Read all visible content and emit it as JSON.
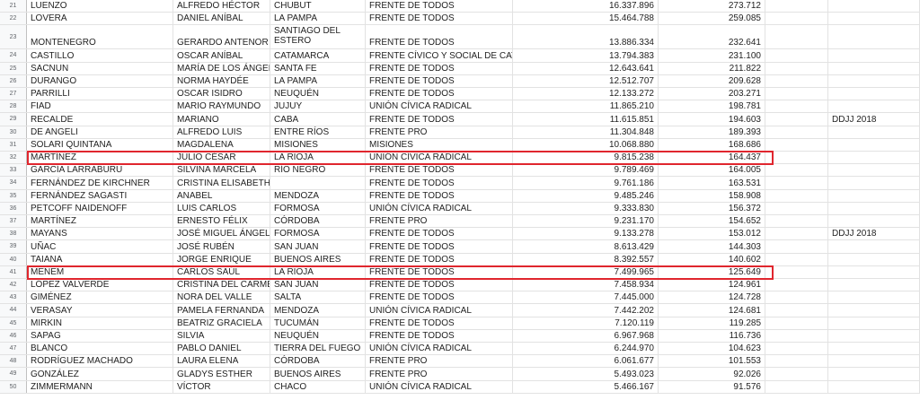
{
  "rows": [
    {
      "n": "21",
      "surname": "LUENZO",
      "name": "ALFREDO HÉCTOR",
      "province": "CHUBUT",
      "party": "FRENTE DE TODOS",
      "value1": "16.337.896",
      "value2": "273.712",
      "note": ""
    },
    {
      "n": "22",
      "surname": "LOVERA",
      "name": "DANIEL ANÍBAL",
      "province": "LA PAMPA",
      "party": "FRENTE DE TODOS",
      "value1": "15.464.788",
      "value2": "259.085",
      "note": ""
    },
    {
      "n": "23",
      "surname": "MONTENEGRO",
      "name": "GERARDO ANTENOR",
      "province": "SANTIAGO DEL ESTERO",
      "party": "FRENTE DE TODOS",
      "value1": "13.886.334",
      "value2": "232.641",
      "note": ""
    },
    {
      "n": "24",
      "surname": "CASTILLO",
      "name": "OSCAR ANÍBAL",
      "province": "CATAMARCA",
      "party": "FRENTE CÍVICO Y SOCIAL DE CATAMARCA",
      "value1": "13.794.383",
      "value2": "231.100",
      "note": ""
    },
    {
      "n": "25",
      "surname": "SACNUN",
      "name": "MARÍA DE LOS ÁNGELES",
      "province": "SANTA FE",
      "party": "FRENTE DE TODOS",
      "value1": "12.643.641",
      "value2": "211.822",
      "note": ""
    },
    {
      "n": "26",
      "surname": "DURANGO",
      "name": "NORMA HAYDÉE",
      "province": "LA PAMPA",
      "party": "FRENTE DE TODOS",
      "value1": "12.512.707",
      "value2": "209.628",
      "note": ""
    },
    {
      "n": "27",
      "surname": "PARRILLI",
      "name": "OSCAR ISIDRO",
      "province": "NEUQUÉN",
      "party": "FRENTE DE TODOS",
      "value1": "12.133.272",
      "value2": "203.271",
      "note": ""
    },
    {
      "n": "28",
      "surname": "FIAD",
      "name": "MARIO RAYMUNDO",
      "province": "JUJUY",
      "party": "UNIÓN CÍVICA RADICAL",
      "value1": "11.865.210",
      "value2": "198.781",
      "note": ""
    },
    {
      "n": "29",
      "surname": "RECALDE",
      "name": "MARIANO",
      "province": "CABA",
      "party": "FRENTE DE TODOS",
      "value1": "11.615.851",
      "value2": "194.603",
      "note": "DDJJ 2018"
    },
    {
      "n": "30",
      "surname": "DE ANGELI",
      "name": "ALFREDO LUIS",
      "province": "ENTRE RÍOS",
      "party": "FRENTE PRO",
      "value1": "11.304.848",
      "value2": "189.393",
      "note": ""
    },
    {
      "n": "31",
      "surname": "SOLARI QUINTANA",
      "name": "MAGDALENA",
      "province": "MISIONES",
      "party": "MISIONES",
      "value1": "10.068.880",
      "value2": "168.686",
      "note": ""
    },
    {
      "n": "32",
      "surname": "MARTÍNEZ",
      "name": "JULIO CÉSAR",
      "province": "LA RIOJA",
      "party": "UNIÓN CÍVICA RADICAL",
      "value1": "9.815.238",
      "value2": "164.437",
      "note": ""
    },
    {
      "n": "33",
      "surname": "GARCÍA LARRABURU",
      "name": "SILVINA MARCELA",
      "province": "RÍO NEGRO",
      "party": "FRENTE DE TODOS",
      "value1": "9.789.469",
      "value2": "164.005",
      "note": ""
    },
    {
      "n": "34",
      "surname": "FERNÁNDEZ DE KIRCHNER",
      "name": "CRISTINA ELISABETH",
      "province": "",
      "party": "FRENTE DE TODOS",
      "value1": "9.761.186",
      "value2": "163.531",
      "note": ""
    },
    {
      "n": "35",
      "surname": "FERNÁNDEZ SAGASTI",
      "name": "ANABEL",
      "province": "MENDOZA",
      "party": "FRENTE DE TODOS",
      "value1": "9.485.246",
      "value2": "158.908",
      "note": ""
    },
    {
      "n": "36",
      "surname": "PETCOFF NAIDENOFF",
      "name": "LUIS CARLOS",
      "province": "FORMOSA",
      "party": "UNIÓN CÍVICA RADICAL",
      "value1": "9.333.830",
      "value2": "156.372",
      "note": ""
    },
    {
      "n": "37",
      "surname": "MARTÍNEZ",
      "name": "ERNESTO FÉLIX",
      "province": "CÓRDOBA",
      "party": "FRENTE PRO",
      "value1": "9.231.170",
      "value2": "154.652",
      "note": ""
    },
    {
      "n": "38",
      "surname": "MAYANS",
      "name": "JOSÉ MIGUEL ÁNGEL",
      "province": "FORMOSA",
      "party": "FRENTE DE TODOS",
      "value1": "9.133.278",
      "value2": "153.012",
      "note": "DDJJ 2018"
    },
    {
      "n": "39",
      "surname": "UÑAC",
      "name": "JOSÉ RUBÉN",
      "province": "SAN JUAN",
      "party": "FRENTE DE TODOS",
      "value1": "8.613.429",
      "value2": "144.303",
      "note": ""
    },
    {
      "n": "40",
      "surname": "TAIANA",
      "name": "JORGE ENRIQUE",
      "province": "BUENOS AIRES",
      "party": "FRENTE DE TODOS",
      "value1": "8.392.557",
      "value2": "140.602",
      "note": ""
    },
    {
      "n": "41",
      "surname": "MENEM",
      "name": "CARLOS SAÚL",
      "province": "LA RIOJA",
      "party": "FRENTE DE TODOS",
      "value1": "7.499.965",
      "value2": "125.649",
      "note": ""
    },
    {
      "n": "42",
      "surname": "LÓPEZ VALVERDE",
      "name": "CRISTINA DEL CARMEN",
      "province": "SAN JUAN",
      "party": "FRENTE DE TODOS",
      "value1": "7.458.934",
      "value2": "124.961",
      "note": ""
    },
    {
      "n": "43",
      "surname": "GIMÉNEZ",
      "name": "NORA DEL VALLE",
      "province": "SALTA",
      "party": "FRENTE DE TODOS",
      "value1": "7.445.000",
      "value2": "124.728",
      "note": ""
    },
    {
      "n": "44",
      "surname": "VERASAY",
      "name": "PAMELA FERNANDA",
      "province": "MENDOZA",
      "party": "UNIÓN CÍVICA RADICAL",
      "value1": "7.442.202",
      "value2": "124.681",
      "note": ""
    },
    {
      "n": "45",
      "surname": "MIRKIN",
      "name": "BEATRIZ GRACIELA",
      "province": "TUCUMÁN",
      "party": "FRENTE DE TODOS",
      "value1": "7.120.119",
      "value2": "119.285",
      "note": ""
    },
    {
      "n": "46",
      "surname": "SAPAG",
      "name": "SILVIA",
      "province": "NEUQUÉN",
      "party": "FRENTE DE TODOS",
      "value1": "6.967.968",
      "value2": "116.736",
      "note": ""
    },
    {
      "n": "47",
      "surname": "BLANCO",
      "name": "PABLO DANIEL",
      "province": "TIERRA DEL FUEGO",
      "party": "UNIÓN CÍVICA RADICAL",
      "value1": "6.244.970",
      "value2": "104.623",
      "note": ""
    },
    {
      "n": "48",
      "surname": "RODRÍGUEZ MACHADO",
      "name": "LAURA ELENA",
      "province": "CÓRDOBA",
      "party": "FRENTE PRO",
      "value1": "6.061.677",
      "value2": "101.553",
      "note": ""
    },
    {
      "n": "49",
      "surname": "GONZÁLEZ",
      "name": "GLADYS ESTHER",
      "province": "BUENOS AIRES",
      "party": "FRENTE PRO",
      "value1": "5.493.023",
      "value2": "92.026",
      "note": ""
    },
    {
      "n": "50",
      "surname": "ZIMMERMANN",
      "name": "VÍCTOR",
      "province": "CHACO",
      "party": "UNIÓN CÍVICA RADICAL",
      "value1": "5.466.167",
      "value2": "91.576",
      "note": ""
    }
  ],
  "highlighted_rows": [
    "32",
    "41"
  ],
  "colors": {
    "highlight": "#e0262e",
    "grid": "#e2e2e2",
    "header_bg": "#f8f9fa"
  }
}
